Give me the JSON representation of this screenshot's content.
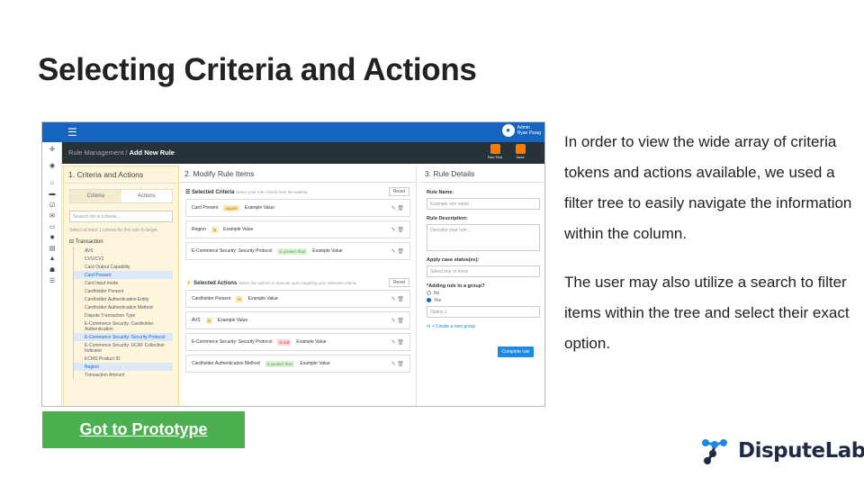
{
  "slide": {
    "title": "Selecting Criteria and Actions",
    "para1": "In order to view the wide array of criteria tokens and actions available, we used a filter tree to easily navigate the information within the column.",
    "para2": "The user may also utilize a search to filter items within the tree and select their exact option.",
    "prototype_link": "Got to Prototype",
    "logo_text": "DisputeLab"
  },
  "app": {
    "user_role": "Admin",
    "user_name": "Ryan Parag",
    "crumb_parent": "Rule Management",
    "crumb_current": "Add New Rule",
    "btn_run": "Run Test",
    "btn_save": "Save",
    "col1_title": "1. Criteria and Actions",
    "tab_criteria": "Criteria",
    "tab_actions": "Actions",
    "search_placeholder": "Search for a criteria...",
    "hint": "Select at least 1 criteria for this rule to target.",
    "tree_root": "Transaction",
    "tree_items": [
      "AVS",
      "CVV/CV2",
      "Card Output Capability",
      "Card Present",
      "Card Input mode",
      "Cardholder Present",
      "Cardholder Authentication Entity",
      "Cardholder Authentication Method",
      "Dispute Transaction Type",
      "E-Commerce Security: Cardholder Authentication",
      "E-Commerce Security: Security Protocol",
      "E-Commerce Security: UCAF Collection Indicator",
      "ECMS Product ID",
      "Region",
      "Transaction Amount"
    ],
    "col2_title": "2. Modify Rule Items",
    "sel_criteria": "Selected Criteria",
    "sel_criteria_hint": "Select your rule criteria from the sidebar.",
    "sel_actions": "Selected Actions",
    "sel_actions_hint": "Select the actions to execute upon targeting your selected criteria.",
    "reset": "Reset",
    "criteria_rows": [
      {
        "name": "Card Present",
        "op": "equals",
        "val": "Example Value"
      },
      {
        "name": "Region",
        "op": "is",
        "val": "Example Value"
      },
      {
        "name": "E-Commerce Security: Security Protocol",
        "op": "is greater than",
        "val": "Example Value"
      }
    ],
    "action_rows": [
      {
        "name": "Cardholder Present",
        "op": "is",
        "val": "Example Value"
      },
      {
        "name": "AVS",
        "op": "is",
        "val": "Example Value"
      },
      {
        "name": "E-Commerce Security: Security Protocol",
        "op": "is not",
        "val": "Example Value"
      },
      {
        "name": "Cardholder Authentication Method",
        "op": "is greater than",
        "val": "Example Value"
      }
    ],
    "col3_title": "3. Rule Details",
    "rule_name_label": "Rule Name:",
    "rule_name_ph": "Example rule name...",
    "rule_desc_label": "Rule Description:",
    "rule_desc_ph": "Describe your rule...",
    "case_label": "Apply case status(es):",
    "case_ph": "Select one or more",
    "group_label": "*Adding rule to a group?",
    "no": "No",
    "yes": "Yes",
    "option": "Option 1",
    "create_group": "or  + Create a new group",
    "complete": "Complete rule"
  }
}
